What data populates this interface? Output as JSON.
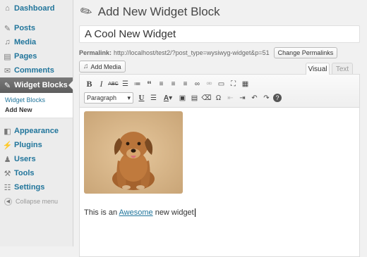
{
  "sidebar": {
    "items": [
      {
        "label": "Dashboard",
        "icon": "dashboard-icon",
        "glyph": "⌂"
      },
      {
        "label": "Posts",
        "icon": "pushpin-icon",
        "glyph": "✎"
      },
      {
        "label": "Media",
        "icon": "media-icon",
        "glyph": "♫"
      },
      {
        "label": "Pages",
        "icon": "pages-icon",
        "glyph": "▤"
      },
      {
        "label": "Comments",
        "icon": "comments-icon",
        "glyph": "✉"
      },
      {
        "label": "Widget Blocks",
        "icon": "pushpin-icon",
        "glyph": "✎"
      },
      {
        "label": "Appearance",
        "icon": "appearance-icon",
        "glyph": "◧"
      },
      {
        "label": "Plugins",
        "icon": "plugins-icon",
        "glyph": "⚡"
      },
      {
        "label": "Users",
        "icon": "users-icon",
        "glyph": "♟"
      },
      {
        "label": "Tools",
        "icon": "tools-icon",
        "glyph": "⚒"
      },
      {
        "label": "Settings",
        "icon": "settings-icon",
        "glyph": "☷"
      }
    ],
    "submenu": [
      "Widget Blocks",
      "Add New"
    ],
    "collapse_label": "Collapse menu"
  },
  "page": {
    "title": "Add New Widget Block",
    "post_title": "A Cool New Widget",
    "permalink_label": "Permalink:",
    "permalink_url": "http://localhost/test2/?post_type=wysiwyg-widget&p=51",
    "change_permalinks": "Change Permalinks",
    "add_media": "Add Media",
    "tab_visual": "Visual",
    "tab_text": "Text"
  },
  "editor": {
    "format_select": "Paragraph",
    "text_before": "This is an ",
    "link_text": "Awesome",
    "text_after": " new widget"
  },
  "colors": {
    "link": "#21759b",
    "current_menu": "#6d6d6d",
    "background": "#f1f1f1"
  }
}
